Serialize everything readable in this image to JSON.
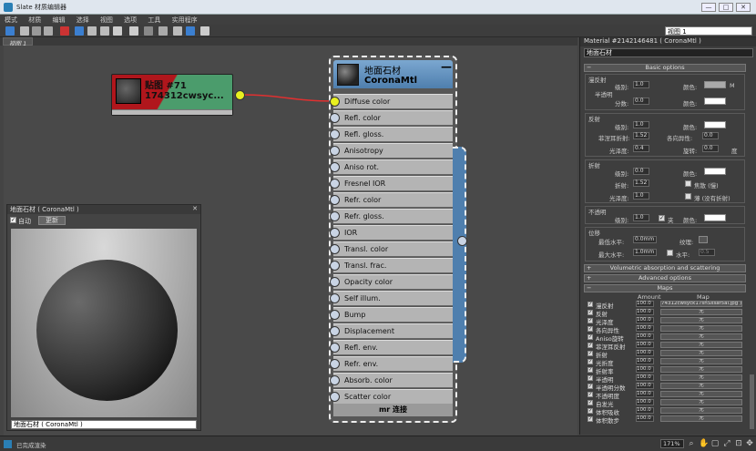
{
  "window": {
    "title": "Slate 材质编辑器",
    "minimize": "—",
    "restore": "□",
    "close": "✕"
  },
  "menu": [
    "模式",
    "材质",
    "编辑",
    "选择",
    "视图",
    "选项",
    "工具",
    "实用程序"
  ],
  "toolbar": {
    "view_select": "视图 1"
  },
  "view_tab": "视图 1",
  "bitmap_node": {
    "title": "贴图 #71",
    "file": "174312cwsyc..."
  },
  "corona_node": {
    "title": "地面石材",
    "type": "CoronaMtl",
    "collapse": "—",
    "slots": [
      "Diffuse color",
      "Refl. color",
      "Refl. gloss.",
      "Anisotropy",
      "Aniso rot.",
      "Fresnel IOR",
      "Refr. color",
      "Refr. gloss.",
      "IOR",
      "Transl. color",
      "Transl. frac.",
      "Opacity color",
      "Self illum.",
      "Bump",
      "Displacement",
      "Refl. env.",
      "Refr. env.",
      "Absorb. color",
      "Scatter color"
    ],
    "footer": "mr 连接"
  },
  "preview": {
    "title": "地面石材 ( CoronaMtl )",
    "close": "✕",
    "auto_label": "自动",
    "update_label": "更新",
    "select_value": "地面石材 ( CoronaMtl )"
  },
  "right_panel": {
    "title": "Material #2142146481 ( CoronaMtl )",
    "name_value": "地面石材",
    "basic_options": "Basic options",
    "diffuse": {
      "header": "漫反射",
      "level_label": "级别:",
      "level_value": "1.0",
      "color_label": "颜色:",
      "m_label": "M",
      "translucency": "半透明",
      "fraction_label": "分数:",
      "fraction_value": "0.0",
      "color2_label": "颜色:"
    },
    "reflection": {
      "header": "反射",
      "level_label": "级别:",
      "level_value": "1.0",
      "color_label": "颜色:",
      "fresnel_label": "菲涅耳折射:",
      "fresnel_value": "1.52",
      "aniso_label": "各向异性:",
      "aniso_value": "0.0",
      "gloss_label": "光泽度:",
      "gloss_value": "0.4",
      "rot_label": "旋转:",
      "rot_value": "0.0",
      "deg": "度"
    },
    "refraction": {
      "header": "折射",
      "level_label": "级别:",
      "level_value": "0.0",
      "color_label": "颜色:",
      "ior_label": "折射:",
      "ior_value": "1.52",
      "caustics_label": "焦散 (慢)",
      "gloss_label": "光泽度:",
      "gloss_value": "1.0",
      "thin_label": "薄 (没有折射)"
    },
    "opacity": {
      "header": "不透明",
      "level_label": "级别:",
      "level_value": "1.0",
      "clip_label": "夹",
      "color_label": "颜色:"
    },
    "displacement": {
      "header": "位移",
      "min_label": "最低水平:",
      "min_value": "0.0mm",
      "texture_label": "纹理:",
      "max_label": "最大水平:",
      "max_value": "1.0mm",
      "water_label": "水平:",
      "water_value": "0.5"
    },
    "volumetric": "Volumetric absorption and scattering",
    "advanced": "Advanced options",
    "maps": "Maps",
    "maps_amount_header": "Amount",
    "maps_map_header": "Map",
    "map_rows": [
      {
        "name": "漫反射",
        "amount": "100.0",
        "map": "74312cwsyck17shSxsaf5al.jpg )"
      },
      {
        "name": "反射",
        "amount": "100.0",
        "map": "无"
      },
      {
        "name": "光泽度",
        "amount": "100.0",
        "map": "无"
      },
      {
        "name": "各向异性",
        "amount": "100.0",
        "map": "无"
      },
      {
        "name": "Aniso旋转",
        "amount": "100.0",
        "map": "无"
      },
      {
        "name": "菲涅耳反射",
        "amount": "100.0",
        "map": "无"
      },
      {
        "name": "折射",
        "amount": "100.0",
        "map": "无"
      },
      {
        "name": "光折度",
        "amount": "100.0",
        "map": "无"
      },
      {
        "name": "折射率",
        "amount": "100.0",
        "map": "无"
      },
      {
        "name": "半透明",
        "amount": "100.0",
        "map": "无"
      },
      {
        "name": "半透明分数",
        "amount": "100.0",
        "map": "无"
      },
      {
        "name": "不透明度",
        "amount": "100.0",
        "map": "无"
      },
      {
        "name": "自发光",
        "amount": "100.0",
        "map": "无"
      },
      {
        "name": "体积吸收",
        "amount": "100.0",
        "map": "无"
      },
      {
        "name": "体积散步",
        "amount": "100.0",
        "map": "无"
      }
    ]
  },
  "status": {
    "text": "已完成渲染",
    "zoom": "171%"
  }
}
